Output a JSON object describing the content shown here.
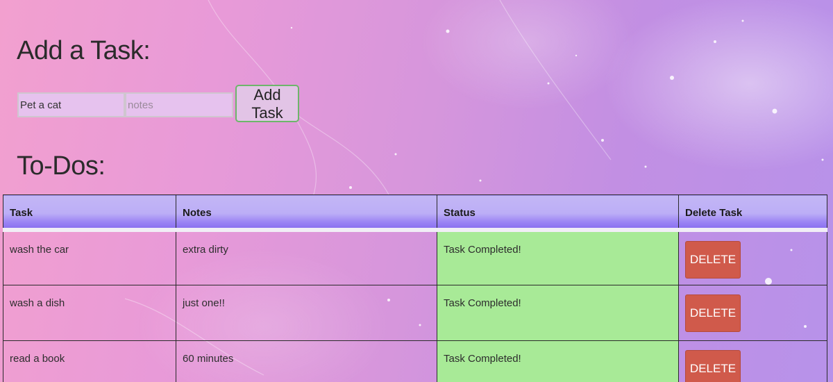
{
  "add_section": {
    "title": "Add a Task:",
    "task_input": {
      "value": "Pet a cat",
      "placeholder": ""
    },
    "notes_input": {
      "value": "",
      "placeholder": "notes"
    },
    "add_button_label": "Add Task"
  },
  "todo_section": {
    "title": "To-Dos:",
    "columns": [
      "Task",
      "Notes",
      "Status",
      "Delete Task"
    ],
    "rows": [
      {
        "task": "wash the car",
        "notes": "extra dirty",
        "status": "Task Completed!",
        "delete_label": "DELETE"
      },
      {
        "task": "wash a dish",
        "notes": "just one!!",
        "status": "Task Completed!",
        "delete_label": "DELETE"
      },
      {
        "task": "read a book",
        "notes": "60 minutes",
        "status": "Task Completed!",
        "delete_label": "DELETE"
      }
    ]
  },
  "colors": {
    "header_bg": "#bcaef6",
    "status_completed_bg": "#a8ea97",
    "delete_button_bg": "#d05a4b",
    "add_button_border": "#6db56a",
    "input_bg": "#e6c2ee"
  }
}
